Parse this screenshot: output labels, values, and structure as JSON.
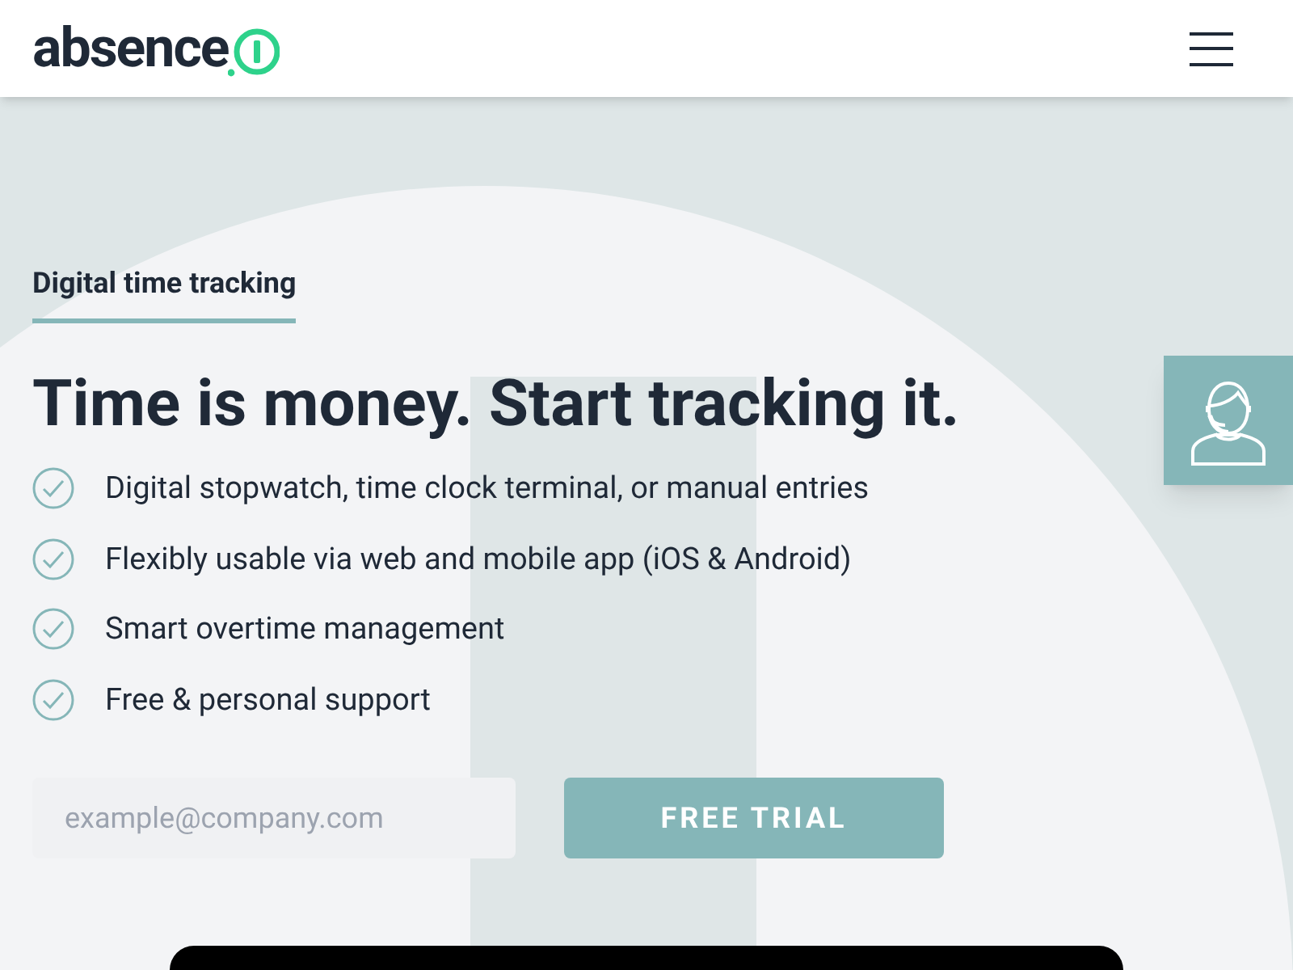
{
  "header": {
    "logo": "absence"
  },
  "hero": {
    "eyebrow": "Digital time tracking",
    "title": "Time is money. Start tracking it.",
    "features": [
      "Digital stopwatch, time clock terminal, or manual entries",
      "Flexibly usable via web and mobile app (iOS & Android)",
      "Smart overtime management",
      "Free & personal support"
    ],
    "email": {
      "placeholder": "example@company.com"
    },
    "button": "FREE TRIAL"
  }
}
